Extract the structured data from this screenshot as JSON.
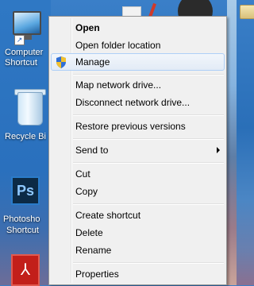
{
  "desktop": {
    "icons": [
      {
        "name": "computer",
        "label": "Computer - Shortcut",
        "line1": "Computer",
        "line2": "Shortcut",
        "shortcut": true
      },
      {
        "name": "recycle-bin",
        "label": "Recycle Bin",
        "line1": "Recycle Bi"
      },
      {
        "name": "photoshop",
        "label": "Photoshop Shortcut",
        "line1": "Photosho",
        "line2": "Shortcut",
        "glyph": "Ps",
        "shortcut": true
      },
      {
        "name": "acrobat",
        "glyph": "⅄"
      }
    ]
  },
  "menu": {
    "items": [
      {
        "id": "open",
        "label": "Open",
        "bold": true
      },
      {
        "id": "open-folder-location",
        "label": "Open folder location"
      },
      {
        "id": "manage",
        "label": "Manage",
        "icon": "uac-shield-icon",
        "hover": true
      },
      {
        "id": "map-network-drive",
        "label": "Map network drive..."
      },
      {
        "id": "disconnect-network-drive",
        "label": "Disconnect network drive..."
      },
      {
        "id": "restore-previous-versions",
        "label": "Restore previous versions"
      },
      {
        "id": "send-to",
        "label": "Send to",
        "submenu": true
      },
      {
        "id": "cut",
        "label": "Cut"
      },
      {
        "id": "copy",
        "label": "Copy"
      },
      {
        "id": "create-shortcut",
        "label": "Create shortcut"
      },
      {
        "id": "delete",
        "label": "Delete"
      },
      {
        "id": "rename",
        "label": "Rename"
      },
      {
        "id": "properties",
        "label": "Properties"
      }
    ]
  },
  "colors": {
    "menu_bg": "#f0f0f0",
    "menu_border": "#979797",
    "hover_border": "#aecff7",
    "shield_blue": "#2f6fd6",
    "shield_yellow": "#f2c12e"
  }
}
